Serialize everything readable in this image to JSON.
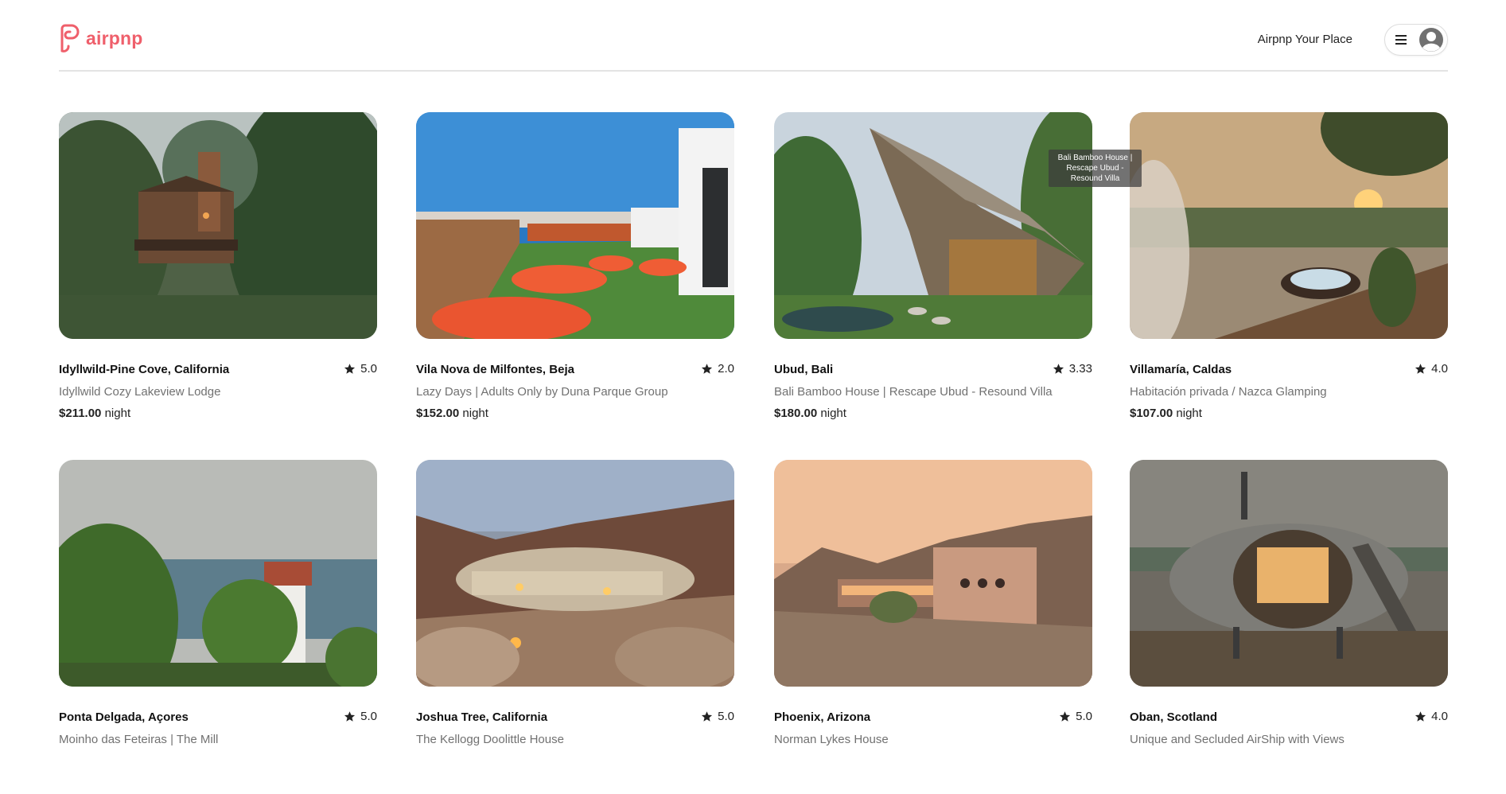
{
  "header": {
    "brand": "airpnp",
    "host_link": "Airpnp Your Place",
    "brand_color": "#ef5f6b",
    "menu_icon": "hamburger-icon",
    "avatar_icon": "user-avatar-icon"
  },
  "tooltip": "Bali Bamboo House | Rescape Ubud - Resound Villa",
  "listings": [
    {
      "location": "Idyllwild-Pine Cove, California",
      "rating": "5.0",
      "name": "Idyllwild Cozy Lakeview Lodge",
      "price": "$211.00",
      "unit": "night"
    },
    {
      "location": "Vila Nova de Milfontes, Beja",
      "rating": "2.0",
      "name": "Lazy Days | Adults Only by Duna Parque Group",
      "price": "$152.00",
      "unit": "night"
    },
    {
      "location": "Ubud, Bali",
      "rating": "3.33",
      "name": "Bali Bamboo House | Rescape Ubud - Resound Villa",
      "price": "$180.00",
      "unit": "night"
    },
    {
      "location": "Villamaría, Caldas",
      "rating": "4.0",
      "name": "Habitación privada / Nazca Glamping",
      "price": "$107.00",
      "unit": "night"
    },
    {
      "location": "Ponta Delgada, Açores",
      "rating": "5.0",
      "name": "Moinho das Feteiras | The Mill",
      "price": "",
      "unit": ""
    },
    {
      "location": "Joshua Tree, California",
      "rating": "5.0",
      "name": "The Kellogg Doolittle House",
      "price": "",
      "unit": ""
    },
    {
      "location": "Phoenix, Arizona",
      "rating": "5.0",
      "name": "Norman Lykes House",
      "price": "",
      "unit": ""
    },
    {
      "location": "Oban, Scotland",
      "rating": "4.0",
      "name": "Unique and Secluded AirShip with Views",
      "price": "",
      "unit": ""
    }
  ]
}
